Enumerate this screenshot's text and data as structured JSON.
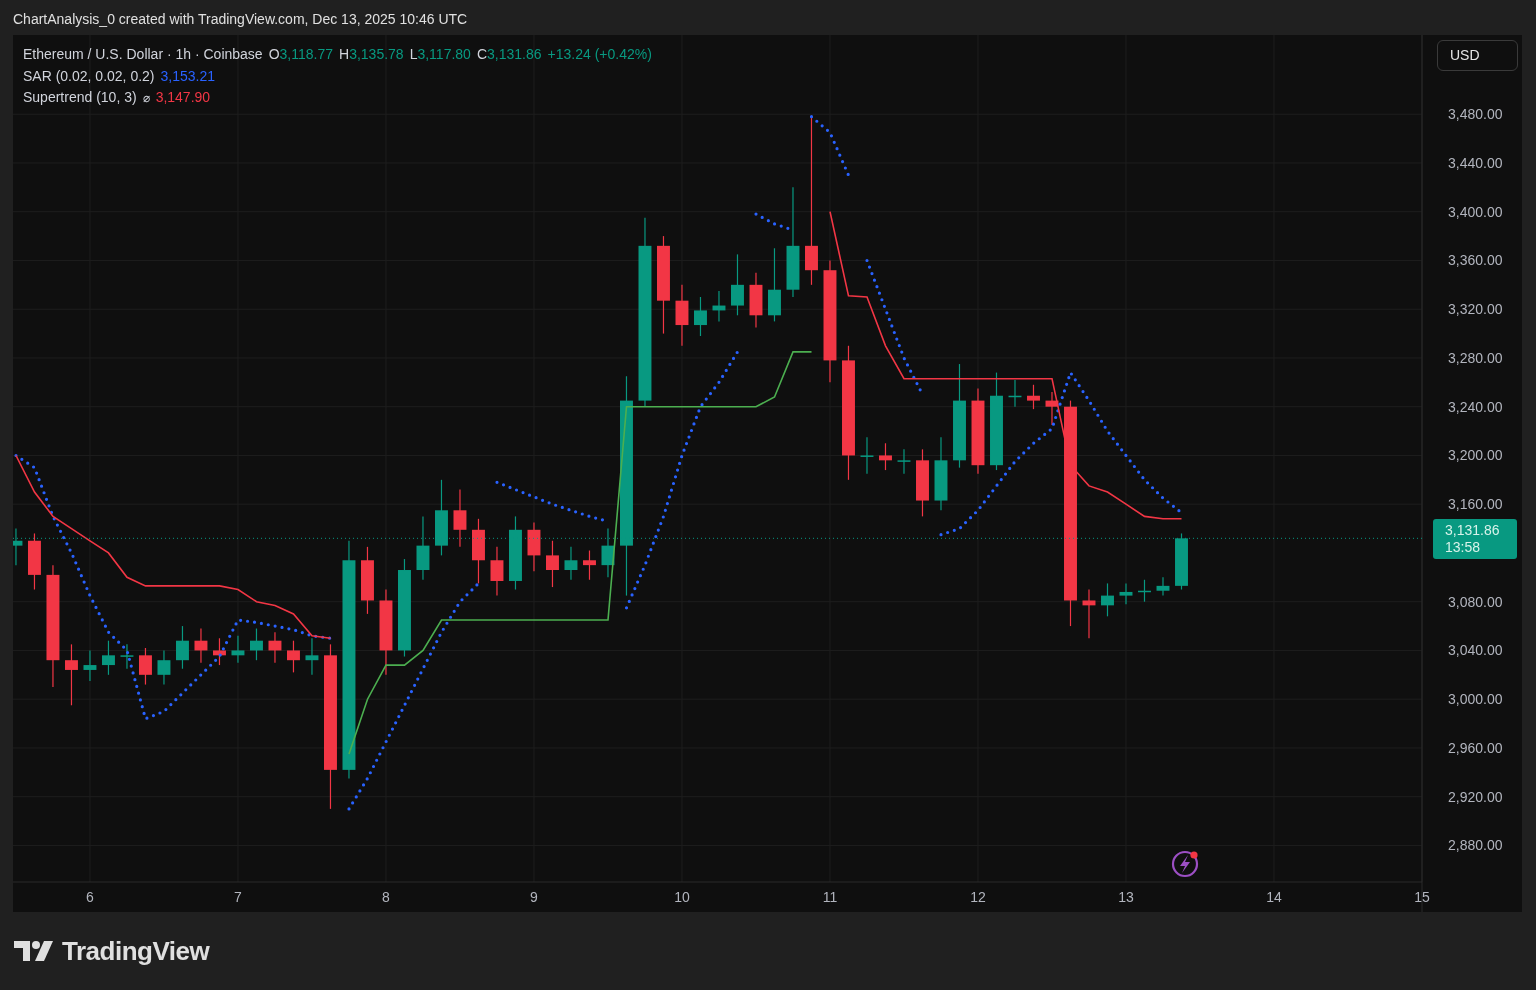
{
  "title": "ChartAnalysis_0 created with TradingView.com, Dec 13, 2025 10:46 UTC",
  "legend": {
    "symbol": "Ethereum / U.S. Dollar · 1h · Coinbase",
    "ohlc": [
      {
        "label": "O",
        "value": "3,118.77"
      },
      {
        "label": "H",
        "value": "3,135.78"
      },
      {
        "label": "L",
        "value": "3,117.80"
      },
      {
        "label": "C",
        "value": "3,131.86"
      }
    ],
    "change": "+13.24 (+0.42%)",
    "indicators": [
      {
        "value": "3,153.21"
      },
      {
        "icon": "⌀",
        "value": "3,147.90"
      }
    ]
  },
  "currency_button": "USD",
  "last_price": {
    "value": "3,131.86",
    "countdown": "13:58"
  },
  "chart": {
    "chart_data": {
      "type": "candlestick",
      "x": [
        5.5,
        5.625,
        5.75,
        5.875,
        6,
        6.125,
        6.25,
        6.375,
        6.5,
        6.625,
        6.75,
        6.875,
        7,
        7.125,
        7.25,
        7.375,
        7.5,
        7.625,
        7.75,
        7.875,
        8,
        8.125,
        8.25,
        8.375,
        8.5,
        8.625,
        8.75,
        8.875,
        9,
        9.125,
        9.25,
        9.375,
        9.5,
        9.625,
        9.75,
        9.875,
        10,
        10.125,
        10.25,
        10.375,
        10.5,
        10.625,
        10.75,
        10.875,
        11,
        11.125,
        11.25,
        11.375,
        11.5,
        11.625,
        11.75,
        11.875,
        12,
        12.125,
        12.25,
        12.375,
        12.5,
        12.625,
        12.75,
        12.875,
        13,
        13.125,
        13.25,
        13.375
      ],
      "ohlc": [
        [
          3126,
          3140,
          3110,
          3130
        ],
        [
          3130,
          3136,
          3090,
          3102
        ],
        [
          3102,
          3110,
          3010,
          3032
        ],
        [
          3032,
          3045,
          2995,
          3024
        ],
        [
          3024,
          3040,
          3015,
          3028
        ],
        [
          3028,
          3048,
          3020,
          3036
        ],
        [
          3036,
          3045,
          3025,
          3036
        ],
        [
          3036,
          3042,
          3012,
          3020
        ],
        [
          3020,
          3040,
          3012,
          3032
        ],
        [
          3032,
          3060,
          3025,
          3048
        ],
        [
          3048,
          3058,
          3030,
          3040
        ],
        [
          3040,
          3050,
          3028,
          3036
        ],
        [
          3036,
          3052,
          3030,
          3040
        ],
        [
          3040,
          3058,
          3032,
          3048
        ],
        [
          3048,
          3055,
          3030,
          3040
        ],
        [
          3040,
          3048,
          3022,
          3032
        ],
        [
          3032,
          3050,
          3020,
          3036
        ],
        [
          3036,
          3045,
          2910,
          2942
        ],
        [
          2942,
          3130,
          2935,
          3114
        ],
        [
          3114,
          3125,
          3070,
          3081
        ],
        [
          3081,
          3090,
          3020,
          3040
        ],
        [
          3040,
          3115,
          3035,
          3106
        ],
        [
          3106,
          3150,
          3098,
          3126
        ],
        [
          3126,
          3180,
          3118,
          3155
        ],
        [
          3155,
          3172,
          3125,
          3139
        ],
        [
          3139,
          3148,
          3095,
          3114
        ],
        [
          3114,
          3125,
          3085,
          3097
        ],
        [
          3097,
          3150,
          3090,
          3139
        ],
        [
          3139,
          3145,
          3105,
          3118
        ],
        [
          3118,
          3130,
          3092,
          3106
        ],
        [
          3106,
          3125,
          3098,
          3114
        ],
        [
          3114,
          3122,
          3098,
          3110
        ],
        [
          3110,
          3140,
          3100,
          3126
        ],
        [
          3126,
          3265,
          3085,
          3245
        ],
        [
          3245,
          3395,
          3240,
          3372
        ],
        [
          3372,
          3380,
          3300,
          3327
        ],
        [
          3327,
          3340,
          3290,
          3307
        ],
        [
          3307,
          3330,
          3298,
          3319
        ],
        [
          3319,
          3335,
          3310,
          3323
        ],
        [
          3323,
          3365,
          3315,
          3340
        ],
        [
          3340,
          3350,
          3305,
          3315
        ],
        [
          3315,
          3370,
          3310,
          3336
        ],
        [
          3336,
          3420,
          3330,
          3372
        ],
        [
          3372,
          3478,
          3340,
          3352
        ],
        [
          3352,
          3360,
          3260,
          3278
        ],
        [
          3278,
          3290,
          3180,
          3200
        ],
        [
          3200,
          3215,
          3185,
          3200
        ],
        [
          3200,
          3210,
          3188,
          3196
        ],
        [
          3196,
          3205,
          3185,
          3196
        ],
        [
          3196,
          3205,
          3150,
          3163
        ],
        [
          3163,
          3215,
          3155,
          3196
        ],
        [
          3196,
          3275,
          3190,
          3245
        ],
        [
          3245,
          3255,
          3185,
          3192
        ],
        [
          3192,
          3268,
          3188,
          3249
        ],
        [
          3249,
          3262,
          3240,
          3249
        ],
        [
          3249,
          3258,
          3238,
          3245
        ],
        [
          3245,
          3252,
          3225,
          3240
        ],
        [
          3240,
          3245,
          3060,
          3081
        ],
        [
          3081,
          3090,
          3050,
          3077
        ],
        [
          3077,
          3095,
          3068,
          3085
        ],
        [
          3085,
          3095,
          3078,
          3088
        ],
        [
          3088,
          3098,
          3080,
          3089
        ],
        [
          3089,
          3100,
          3085,
          3093
        ],
        [
          3093,
          3136,
          3090,
          3132
        ]
      ],
      "series": [
        {
          "name": "SAR (0.02, 0.02, 0.2)",
          "type": "line",
          "line_style": "dotted",
          "color": "#2962ff",
          "values": [
            3200,
            3190,
            3150,
            3120,
            3085,
            3055,
            3040,
            2984,
            2990,
            3005,
            3020,
            3035,
            3065,
            3063,
            3060,
            3057,
            3052,
            3050,
            2910,
            2935,
            2965,
            2995,
            3025,
            3055,
            3080,
            3095,
            3178,
            3172,
            3166,
            3160,
            3155,
            3150,
            3146,
            3075,
            3110,
            3150,
            3200,
            3240,
            3260,
            3285,
            3398,
            3390,
            3385,
            3478,
            3465,
            3430,
            3360,
            3320,
            3280,
            3250,
            3135,
            3140,
            3155,
            3175,
            3195,
            3210,
            3222,
            3268,
            3245,
            3220,
            3200,
            3180,
            3165,
            3153
          ]
        },
        {
          "name": "Supertrend (10, 3)",
          "type": "line",
          "color": "#f23645",
          "values": [
            3200,
            3170,
            3150,
            3140,
            3130,
            3120,
            3100,
            3093,
            3093,
            3093,
            3093,
            3093,
            3090,
            3080,
            3077,
            3070,
            3052,
            3050,
            null,
            null,
            null,
            null,
            null,
            null,
            null,
            null,
            null,
            null,
            null,
            null,
            null,
            null,
            null,
            null,
            null,
            null,
            null,
            null,
            null,
            null,
            null,
            null,
            null,
            null,
            3400,
            3331,
            3330,
            3290,
            3263,
            3263,
            3263,
            3263,
            3263,
            3263,
            3263,
            3263,
            3263,
            3192,
            3175,
            3170,
            3160,
            3150,
            3148,
            3148
          ]
        },
        {
          "type": "line",
          "color": "#4caf50",
          "values": [
            null,
            null,
            null,
            null,
            null,
            null,
            null,
            null,
            null,
            null,
            null,
            null,
            null,
            null,
            null,
            null,
            null,
            null,
            2955,
            3000,
            3028,
            3028,
            3040,
            3065,
            3065,
            3065,
            3065,
            3065,
            3065,
            3065,
            3065,
            3065,
            3065,
            3240,
            3240,
            3240,
            3240,
            3240,
            3240,
            3240,
            3240,
            3248,
            3285,
            3285,
            null,
            null,
            null,
            null,
            null,
            null,
            null,
            null,
            null,
            null,
            null,
            null,
            null,
            null,
            null,
            null,
            null,
            null,
            null,
            null
          ]
        }
      ],
      "ref_lines": [
        {
          "axis": "y",
          "value": 3132,
          "color": "#089981",
          "line_style": "dotted"
        }
      ],
      "grid": true,
      "xlim": [
        5.48,
        15.0
      ],
      "ylim": [
        2850,
        3545
      ],
      "xticks": [
        6,
        7,
        8,
        9,
        10,
        11,
        12,
        13,
        14,
        15
      ],
      "yticks": [
        {
          "value": 2880,
          "label": "2,880.00"
        },
        {
          "value": 2920,
          "label": "2,920.00"
        },
        {
          "value": 2960,
          "label": "2,960.00"
        },
        {
          "value": 3000,
          "label": "3,000.00"
        },
        {
          "value": 3040,
          "label": "3,040.00"
        },
        {
          "value": 3080,
          "label": "3,080.00"
        },
        {
          "value": 3160,
          "label": "3,160.00"
        },
        {
          "value": 3200,
          "label": "3,200.00"
        },
        {
          "value": 3240,
          "label": "3,240.00"
        },
        {
          "value": 3280,
          "label": "3,280.00"
        },
        {
          "value": 3320,
          "label": "3,320.00"
        },
        {
          "value": 3360,
          "label": "3,360.00"
        },
        {
          "value": 3400,
          "label": "3,400.00"
        },
        {
          "value": 3440,
          "label": "3,440.00"
        },
        {
          "value": 3480,
          "label": "3,480.00"
        }
      ]
    }
  },
  "brand": "TradingView"
}
